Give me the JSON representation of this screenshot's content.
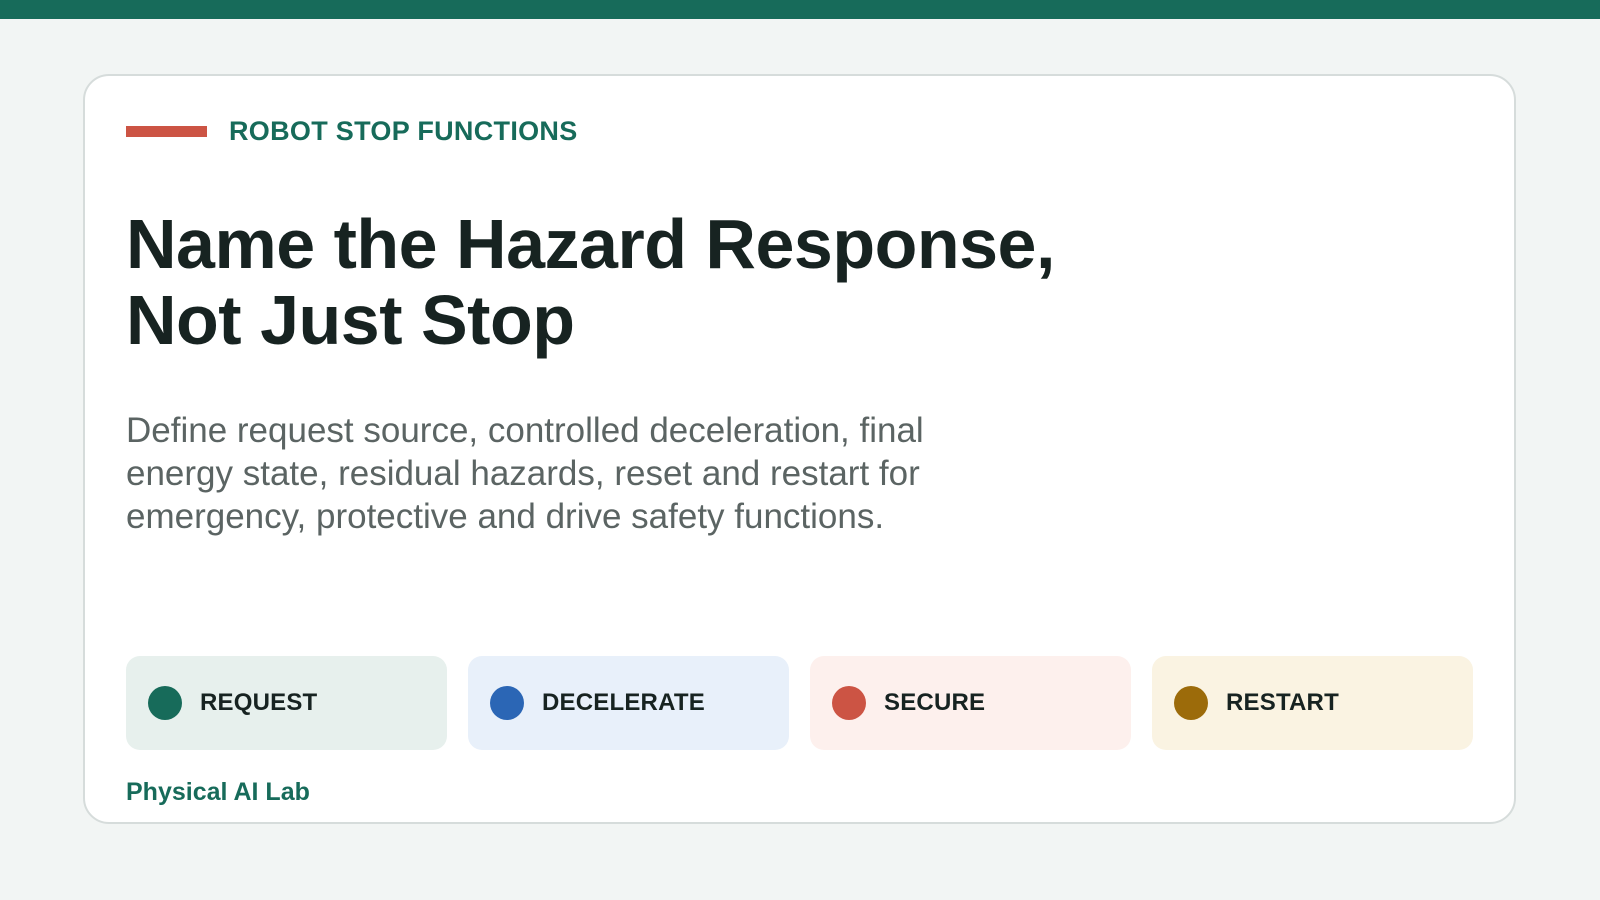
{
  "header": {
    "eyebrow": "ROBOT STOP FUNCTIONS",
    "title_lines": [
      "Name the Hazard Response,",
      "Not Just Stop"
    ],
    "subtitle": "Define request source, controlled deceleration, final energy state, residual hazards, reset and restart for emergency, protective and drive safety functions."
  },
  "steps": [
    {
      "label": "REQUEST",
      "dot_color": "#176b5a",
      "bg_color": "#e7f0ed"
    },
    {
      "label": "DECELERATE",
      "dot_color": "#2b66b5",
      "bg_color": "#e8f0fa"
    },
    {
      "label": "SECURE",
      "dot_color": "#cc5444",
      "bg_color": "#fdf0ed"
    },
    {
      "label": "RESTART",
      "dot_color": "#9c6b0a",
      "bg_color": "#faf3e2"
    }
  ],
  "footer": {
    "brand": "Physical AI Lab"
  },
  "colors": {
    "accent": "#176b5a",
    "eyebrow_rule": "#cc5444",
    "page_bg": "#f2f5f4",
    "card_bg": "#ffffff"
  }
}
